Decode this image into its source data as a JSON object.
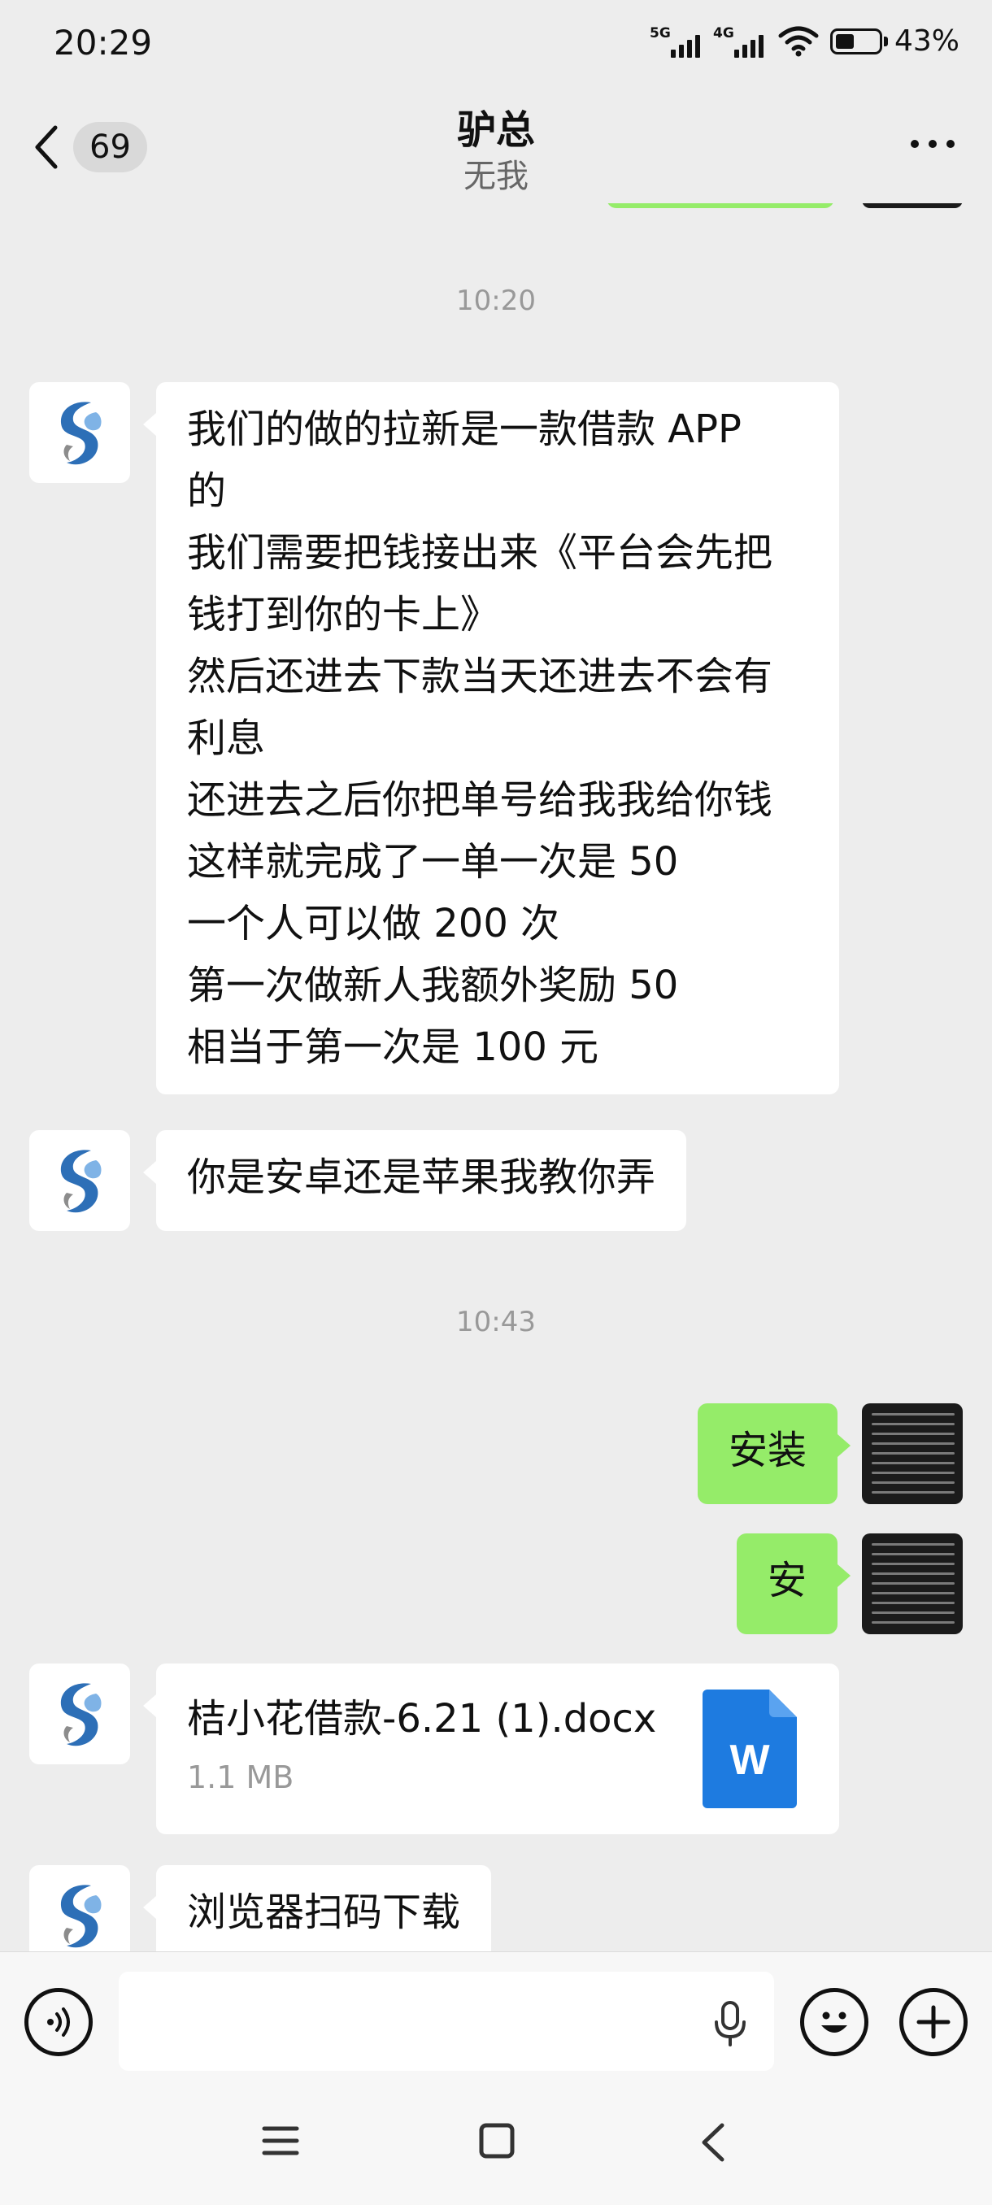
{
  "status_bar": {
    "time": "20:29",
    "network_1": "5G",
    "network_2": "4G",
    "battery_percent": "43%",
    "battery_level": 0.43
  },
  "header": {
    "back_count": "69",
    "title": "驴总",
    "subtitle": "无我"
  },
  "messages": {
    "timestamp_1": "10:20",
    "msg1_lines": [
      "我们的做的拉新是一款借款 APP",
      "的",
      "我们需要把钱接出来《平台会先把",
      "钱打到你的卡上》",
      "然后还进去下款当天还进去不会有",
      "利息",
      "还进去之后你把单号给我我给你钱",
      "这样就完成了一单一次是 50",
      "一个人可以做 200 次",
      "第一次做新人我额外奖励 50",
      "相当于第一次是 100 元"
    ],
    "msg2": "你是安卓还是苹果我教你弄",
    "timestamp_2": "10:43",
    "my_msg1": "安装",
    "my_msg2": "安",
    "file": {
      "name": "桔小花借款-6.21 (1).docx",
      "size": "1.1 MB",
      "icon_letter": "W"
    },
    "msg3": "浏览器扫码下载"
  },
  "input_bar": {
    "placeholder": ""
  },
  "colors": {
    "background": "#ededed",
    "my_bubble": "#95ec69",
    "their_bubble": "#ffffff",
    "word_blue": "#1e7be0"
  }
}
